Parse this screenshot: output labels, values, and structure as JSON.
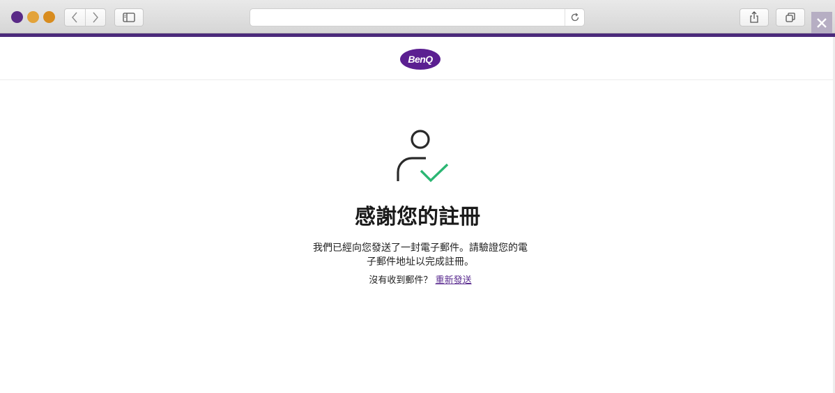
{
  "browser": {
    "address_value": "",
    "icons": {
      "back": "chevron-left-icon",
      "forward": "chevron-right-icon",
      "sidebar": "sidebar-icon",
      "reload": "reload-icon",
      "share": "share-icon",
      "tabs": "tabs-overview-icon",
      "close": "close-icon"
    },
    "colors": {
      "traffic_close": "#5a2a87",
      "traffic_min": "#e3a33a",
      "traffic_max": "#d88c1f",
      "brand_bar": "#4b2a7b",
      "close_x_bg": "#b6aec3"
    }
  },
  "header": {
    "logo_text": "BenQ",
    "logo_color": "#5b1f91"
  },
  "main": {
    "icon": "user-check-icon",
    "icon_check_color": "#2bb673",
    "title": "感謝您的註冊",
    "message_line1": "我們已經向您發送了一封電子郵件。請驗證您的電",
    "message_line2": "子郵件地址以完成註冊。",
    "resend_prompt": "沒有收到郵件？",
    "resend_link": "重新發送",
    "link_color": "#5b2d90"
  }
}
